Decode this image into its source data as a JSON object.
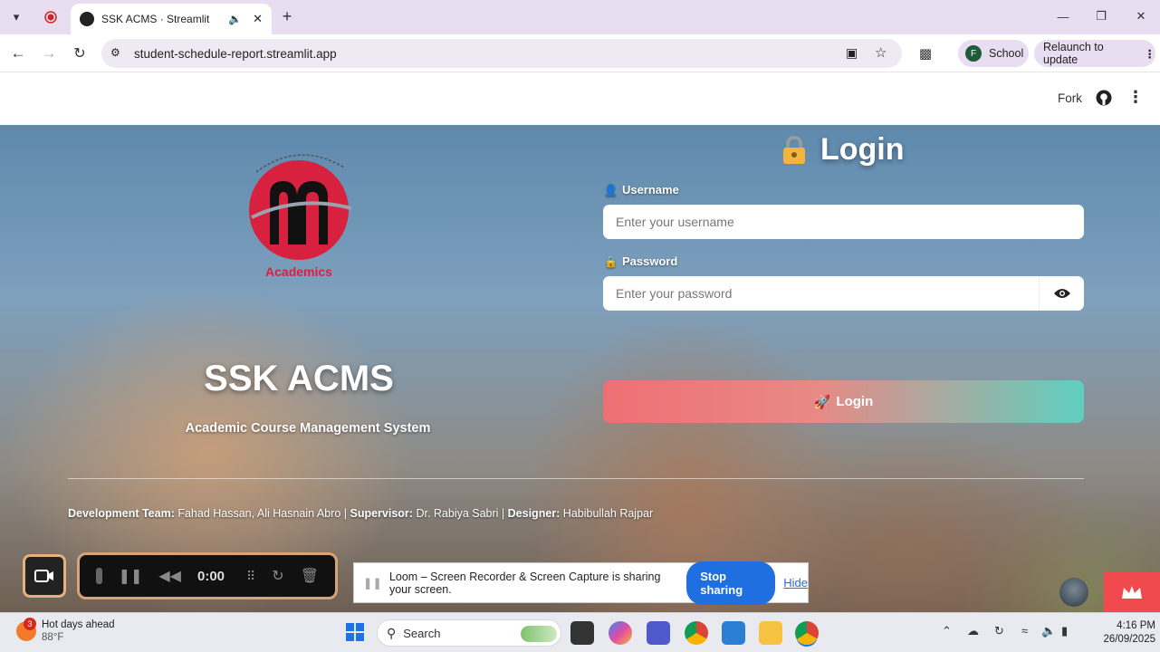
{
  "browser": {
    "tab_title": "SSK ACMS · Streamlit",
    "url": "student-schedule-report.streamlit.app",
    "profile_name": "School",
    "profile_initial": "F",
    "relaunch_label": "Relaunch to update"
  },
  "streamlit_header": {
    "fork_label": "Fork"
  },
  "branding": {
    "logo_caption": "Academics",
    "title": "SSK ACMS",
    "subtitle": "Academic Course Management System"
  },
  "login": {
    "heading": "Login",
    "username_label": "Username",
    "username_placeholder": "Enter your username",
    "password_label": "Password",
    "password_placeholder": "Enter your password",
    "submit_label": "Login",
    "button_gradient": [
      "#ef6f75",
      "#5fcfbf"
    ]
  },
  "credits": {
    "dev_team_label": "Development Team:",
    "dev_team_value": " Fahad Hassan, Ali Hasnain Abro | ",
    "supervisor_label": "Supervisor:",
    "supervisor_value": " Dr. Rabiya Sabri | ",
    "designer_label": "Designer:",
    "designer_value": " Habibullah Rajpar"
  },
  "loom": {
    "timer": "0:00",
    "sharing_message": "Loom – Screen Recorder & Screen Capture is sharing your screen.",
    "stop_label": "Stop sharing",
    "hide_label": "Hide"
  },
  "taskbar": {
    "weather_title": "Hot days ahead",
    "weather_temp": "88°F",
    "weather_badge": "3",
    "search_label": "Search",
    "time": "4:16 PM",
    "date": "26/09/2025"
  }
}
